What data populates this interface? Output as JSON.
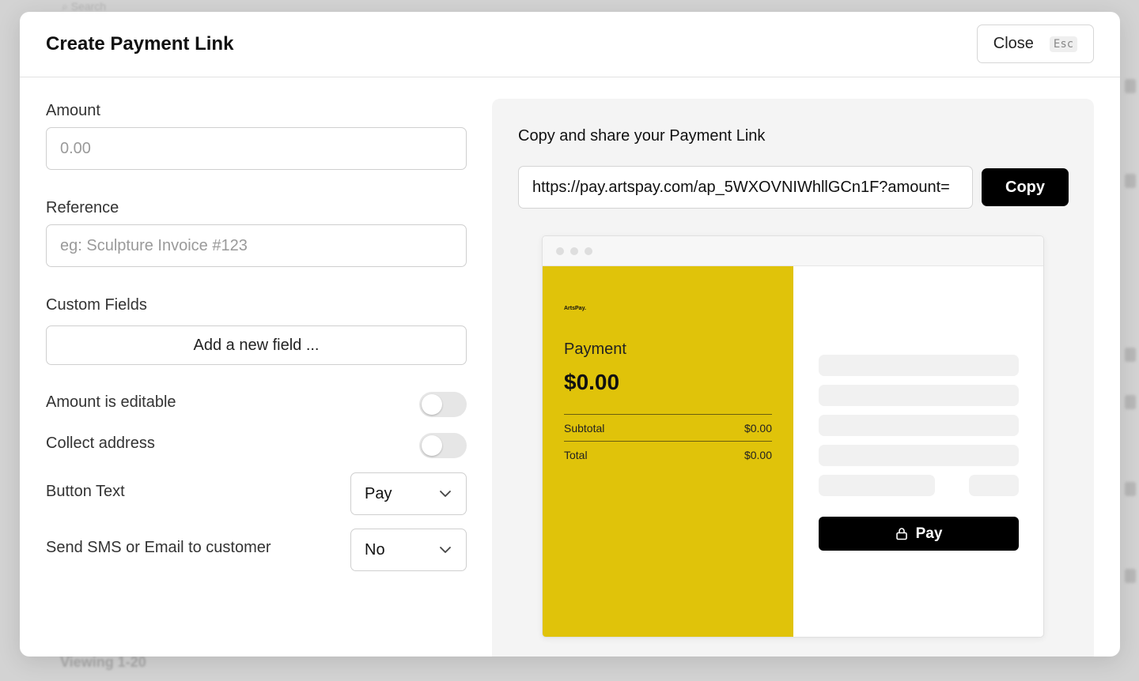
{
  "background": {
    "search_placeholder": "Search",
    "viewing_text": "Viewing 1-20"
  },
  "modal": {
    "title": "Create Payment Link",
    "close_label": "Close",
    "close_shortcut": "Esc"
  },
  "form": {
    "amount": {
      "label": "Amount",
      "placeholder": "0.00",
      "value": ""
    },
    "reference": {
      "label": "Reference",
      "placeholder": "eg: Sculpture Invoice #123",
      "value": ""
    },
    "custom_fields": {
      "label": "Custom Fields",
      "add_button": "Add a new field ..."
    },
    "amount_editable": {
      "label": "Amount is editable",
      "enabled": false
    },
    "collect_address": {
      "label": "Collect address",
      "enabled": false
    },
    "button_text": {
      "label": "Button Text",
      "value": "Pay"
    },
    "send_sms_email": {
      "label": "Send SMS or Email to customer",
      "value": "No"
    }
  },
  "share": {
    "title": "Copy and share your Payment Link",
    "url": "https://pay.artspay.com/ap_5WXOVNIWhllGCn1F?amount=",
    "copy_label": "Copy"
  },
  "preview": {
    "brand": "ArtsPay.",
    "heading": "Payment",
    "amount": "$0.00",
    "subtotal_label": "Subtotal",
    "subtotal_value": "$0.00",
    "total_label": "Total",
    "total_value": "$0.00",
    "pay_button": "Pay",
    "accent_color": "#e0c30a"
  }
}
